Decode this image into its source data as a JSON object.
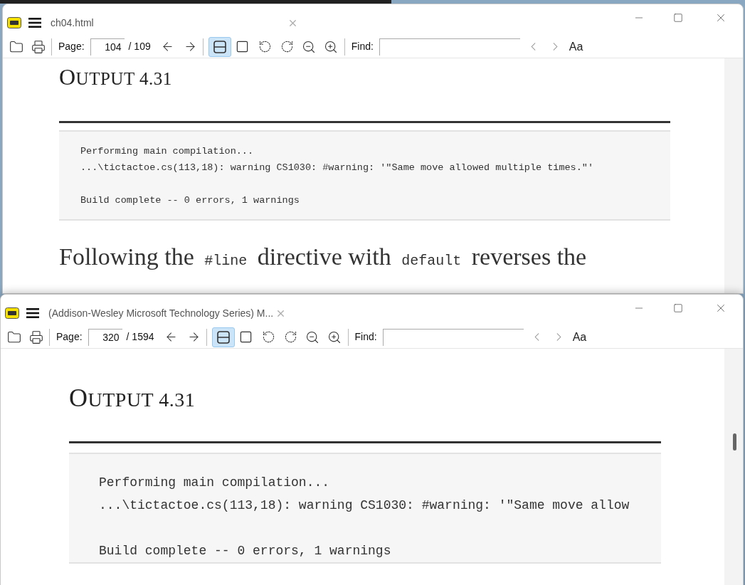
{
  "windows": [
    {
      "title": "ch04.html",
      "toolbar": {
        "page_label": "Page:",
        "page_value": "104",
        "page_total": "/ 109",
        "find_label": "Find:",
        "match_case": "Aa",
        "view_buttons": [
          {
            "kind": "continuous",
            "selected": true
          },
          {
            "kind": "single",
            "selected": false
          }
        ]
      },
      "content": {
        "heading": "OUTPUT 4.31",
        "code_groups": [
          [
            "Performing main compilation...",
            "...\\tictactoe.cs(113,18): warning CS1030: #warning: '\"Same move allowed multiple times.\"'"
          ],
          [
            "Build complete -- 0 errors, 1 warnings"
          ]
        ],
        "paragraph": [
          {
            "kind": "text",
            "text": "Following the "
          },
          {
            "kind": "code",
            "text": "#line"
          },
          {
            "kind": "text",
            "text": " directive with "
          },
          {
            "kind": "code",
            "text": "default"
          },
          {
            "kind": "text",
            "text": " reverses the"
          }
        ]
      }
    },
    {
      "title": "(Addison-Wesley Microsoft Technology Series) M...",
      "toolbar": {
        "page_label": "Page:",
        "page_value": "320",
        "page_total": "/ 1594",
        "find_label": "Find:",
        "match_case": "Aa",
        "view_buttons": [
          {
            "kind": "continuous",
            "selected": true
          },
          {
            "kind": "single",
            "selected": false
          }
        ]
      },
      "content": {
        "heading": "OUTPUT 4.31",
        "code_groups": [
          [
            "Performing main compilation...",
            "...\\tictactoe.cs(113,18): warning CS1030: #warning: '\"Same move allow"
          ],
          [
            "Build complete -- 0 errors, 1 warnings"
          ]
        ]
      }
    }
  ]
}
